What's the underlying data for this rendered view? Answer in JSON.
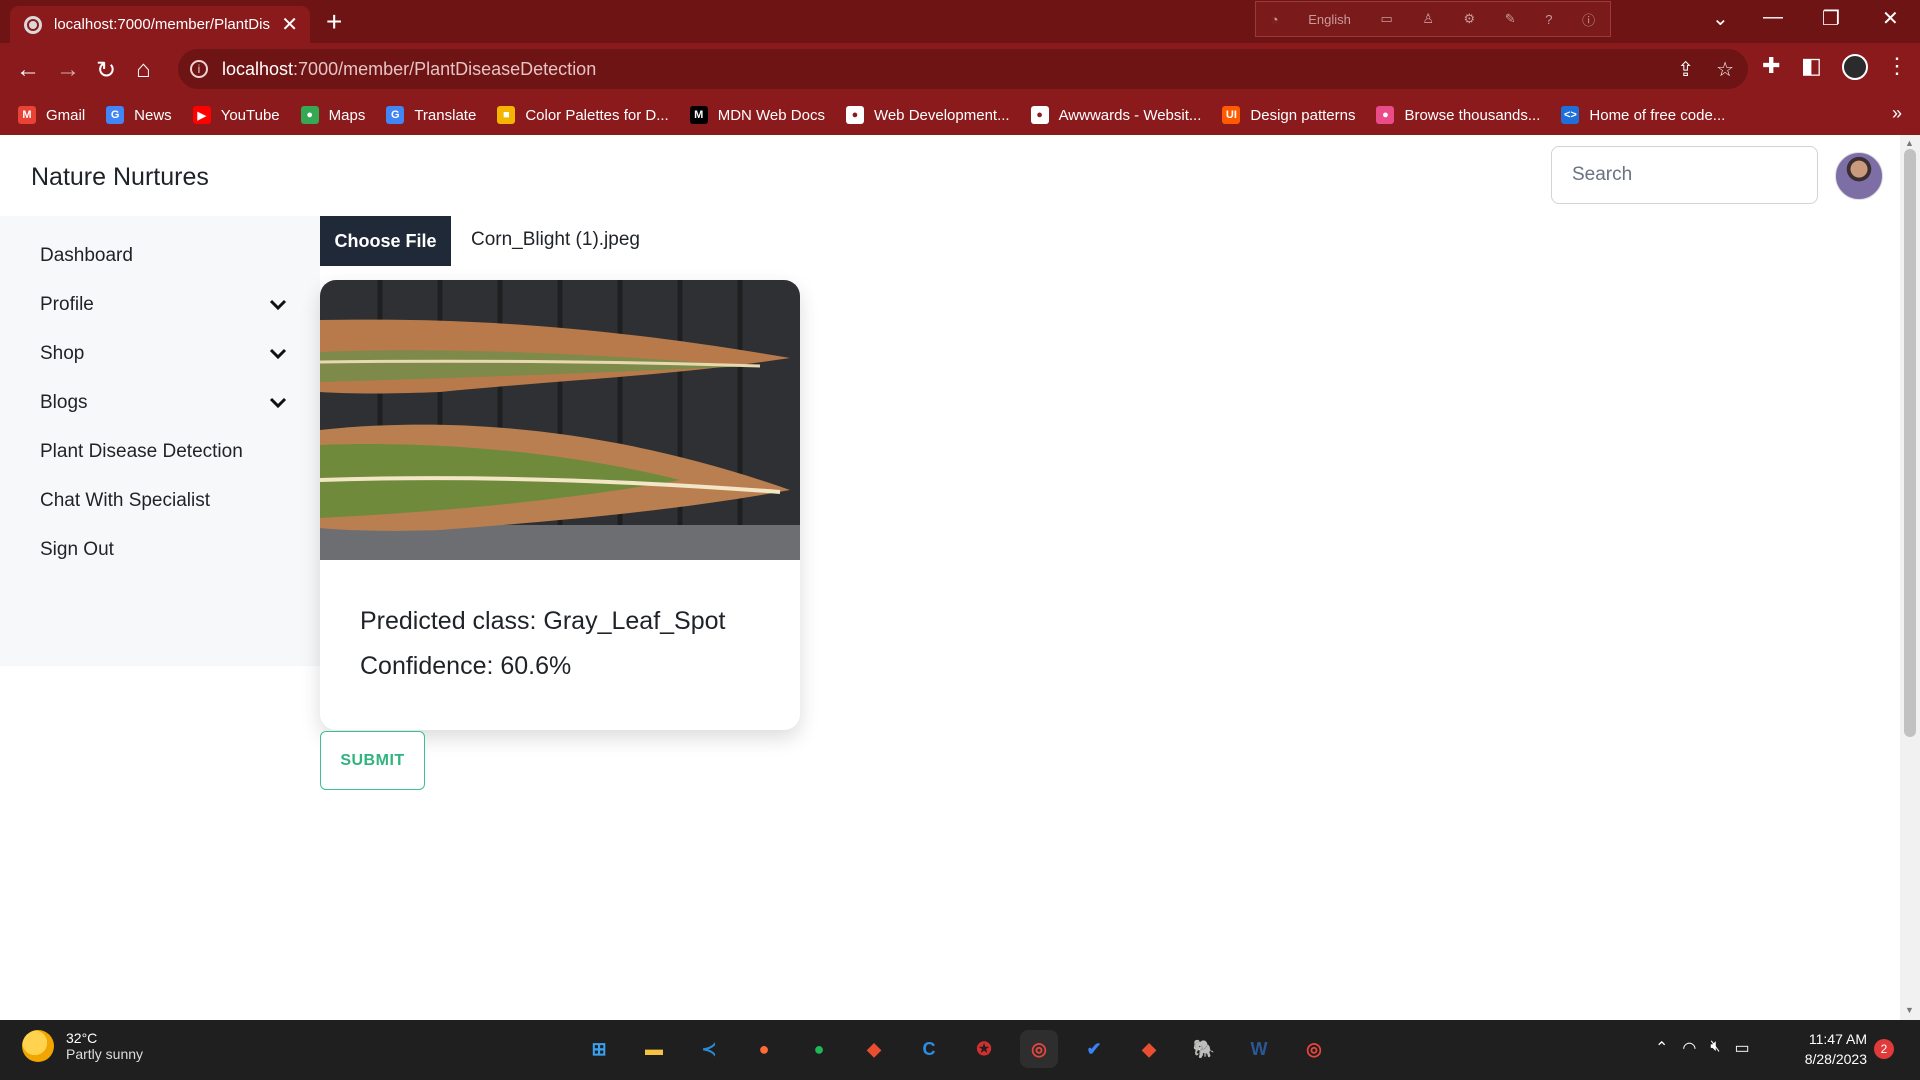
{
  "browser": {
    "tab_title": "localhost:7000/member/PlantDis",
    "url_host": "localhost",
    "url_path": ":7000/member/PlantDiseaseDetection",
    "ime_label": "English",
    "bookmarks": [
      {
        "label": "Gmail",
        "icon": "gmail-icon",
        "color": "#ea4335",
        "glyph": "M"
      },
      {
        "label": "News",
        "icon": "google-news-icon",
        "color": "#4285f4",
        "glyph": "G"
      },
      {
        "label": "YouTube",
        "icon": "youtube-icon",
        "color": "#ff0000",
        "glyph": "▶"
      },
      {
        "label": "Maps",
        "icon": "maps-icon",
        "color": "#34a853",
        "glyph": "●"
      },
      {
        "label": "Translate",
        "icon": "translate-icon",
        "color": "#4285f4",
        "glyph": "G"
      },
      {
        "label": "Color Palettes for D...",
        "icon": "color-palettes-icon",
        "color": "#f4b400",
        "glyph": "■"
      },
      {
        "label": "MDN Web Docs",
        "icon": "mdn-icon",
        "color": "#000000",
        "glyph": "M"
      },
      {
        "label": "Web Development...",
        "icon": "web-dev-icon",
        "color": "#ffffff",
        "glyph": "●"
      },
      {
        "label": "Awwwards - Websit...",
        "icon": "awwwards-icon",
        "color": "#ffffff",
        "glyph": "●"
      },
      {
        "label": "Design patterns",
        "icon": "ui-design-icon",
        "color": "#ff5a00",
        "glyph": "UI"
      },
      {
        "label": "Browse thousands...",
        "icon": "dribbble-icon",
        "color": "#ea4c89",
        "glyph": "●"
      },
      {
        "label": "Home of free code...",
        "icon": "code-icon",
        "color": "#1e6fd9",
        "glyph": "<>"
      }
    ]
  },
  "app": {
    "brand": "Nature Nurtures",
    "search_placeholder": "Search",
    "nav": [
      {
        "label": "Dashboard",
        "has_chevron": false
      },
      {
        "label": "Profile",
        "has_chevron": true
      },
      {
        "label": "Shop",
        "has_chevron": true
      },
      {
        "label": "Blogs",
        "has_chevron": true
      },
      {
        "label": "Plant Disease Detection",
        "has_chevron": false
      },
      {
        "label": "Chat With Specialist",
        "has_chevron": false
      },
      {
        "label": "Sign Out",
        "has_chevron": false
      }
    ],
    "upload": {
      "button_label": "Choose File",
      "file_name": "Corn_Blight (1).jpeg"
    },
    "result": {
      "predicted": "Predicted class: Gray_Leaf_Spot",
      "confidence": "Confidence: 60.6%"
    },
    "submit_label": "SUBMIT",
    "accent_color": "#2fb37f"
  },
  "taskbar": {
    "temperature": "32°C",
    "weather": "Partly sunny",
    "time": "11:47 AM",
    "date": "8/28/2023",
    "notifications": "2",
    "apps": [
      {
        "name": "windows-start-icon",
        "color": "#3aa0f0",
        "glyph": "⊞"
      },
      {
        "name": "file-explorer-icon",
        "color": "#f5c242",
        "glyph": "▬"
      },
      {
        "name": "vscode-icon",
        "color": "#2a8ad4",
        "glyph": "≺"
      },
      {
        "name": "postman-icon",
        "color": "#ff6c37",
        "glyph": "●"
      },
      {
        "name": "spotify-icon",
        "color": "#1db954",
        "glyph": "●"
      },
      {
        "name": "git-icon",
        "color": "#e94e31",
        "glyph": "◆"
      },
      {
        "name": "ccleaner-icon",
        "color": "#2b8ee8",
        "glyph": "C"
      },
      {
        "name": "app-icon",
        "color": "#d32f2f",
        "glyph": "✪"
      },
      {
        "name": "chrome-icon",
        "color": "#e8453c",
        "glyph": "◎"
      },
      {
        "name": "todo-icon",
        "color": "#3b82f6",
        "glyph": "✔"
      },
      {
        "name": "git-gui-icon",
        "color": "#e94e31",
        "glyph": "◆"
      },
      {
        "name": "postgresql-icon",
        "color": "#7fa7d6",
        "glyph": "🐘"
      },
      {
        "name": "word-icon",
        "color": "#2b5797",
        "glyph": "W"
      },
      {
        "name": "chrome-profile-icon",
        "color": "#e8453c",
        "glyph": "◎"
      }
    ]
  }
}
